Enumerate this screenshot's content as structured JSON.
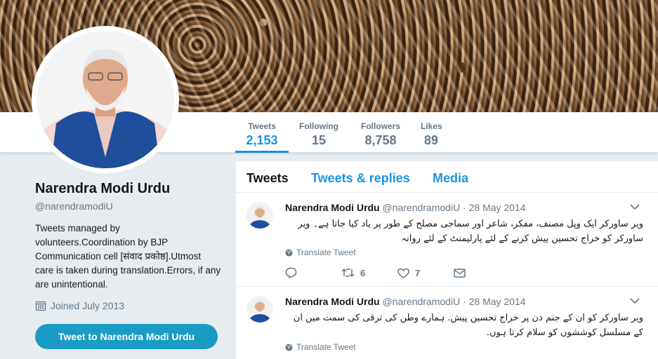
{
  "profile": {
    "name": "Narendra Modi Urdu",
    "handle": "@narendramodiU",
    "bio": "Tweets managed by volunteers.Coordination by BJP Communication cell [संवाद प्रकोष्ठ].Utmost care is taken during translation.Errors, if any are unintentional.",
    "joined": "Joined July 2013",
    "tweet_to_button": "Tweet to Narendra Modi Urdu"
  },
  "stats": {
    "tweets": {
      "label": "Tweets",
      "value": "2,153"
    },
    "following": {
      "label": "Following",
      "value": "15"
    },
    "followers": {
      "label": "Followers",
      "value": "8,758"
    },
    "likes": {
      "label": "Likes",
      "value": "89"
    }
  },
  "tabs": {
    "tweets": "Tweets",
    "replies": "Tweets & replies",
    "media": "Media"
  },
  "tweets": [
    {
      "name": "Narendra Modi Urdu",
      "handle": "@narendramodiU",
      "sep": "·",
      "date": "28 May 2014",
      "text": "ویر ساورکر ایک وپل مصنف، مفکر، شاعر اور سماجی مصلح کے طور پر یاد کیا جاتا ہے۔ ویر ساورکر کو خراج تحسین پیش کرنے کے لئے پارلیمنٹ کے لئے روانہ",
      "translate": "Translate Tweet",
      "retweets": "6",
      "likes": "7"
    },
    {
      "name": "Narendra Modi Urdu",
      "handle": "@narendramodiU",
      "sep": "·",
      "date": "28 May 2014",
      "text": "ویر ساورکر کو ان کے جنم دن پر خراج تحسین پیش. ہمارے وطن کی ترقی کی سمت میں ان کے مسلسل کوششوں کو سلام کرتا ہوں.",
      "translate": "Translate Tweet"
    }
  ],
  "colors": {
    "accent": "#1b95e0",
    "button": "#1a9bc4",
    "muted": "#657786"
  }
}
